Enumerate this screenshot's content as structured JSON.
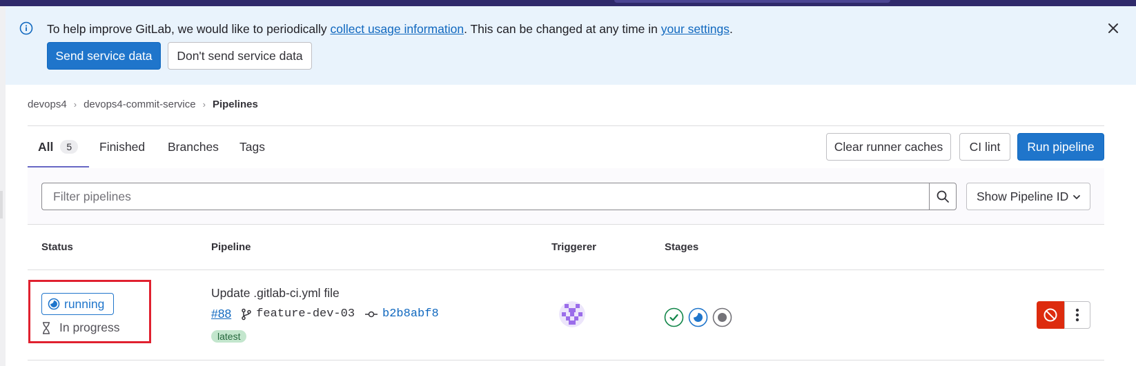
{
  "banner": {
    "text_before": "To help improve GitLab, we would like to periodically ",
    "link_usage": "collect usage information",
    "text_middle": ". This can be changed at any time in ",
    "link_settings": "your settings",
    "text_after": ".",
    "send_button": "Send service data",
    "dont_send_button": "Don't send service data"
  },
  "breadcrumb": {
    "items": [
      "devops4",
      "devops4-commit-service",
      "Pipelines"
    ]
  },
  "tabs": [
    {
      "label": "All",
      "count": "5"
    },
    {
      "label": "Finished"
    },
    {
      "label": "Branches"
    },
    {
      "label": "Tags"
    }
  ],
  "actions": {
    "clear_caches": "Clear runner caches",
    "ci_lint": "CI lint",
    "run_pipeline": "Run pipeline"
  },
  "filter": {
    "placeholder": "Filter pipelines",
    "show_id": "Show Pipeline ID"
  },
  "table": {
    "headers": [
      "Status",
      "Pipeline",
      "Triggerer",
      "Stages"
    ],
    "rows": [
      {
        "status": "running",
        "duration": "In progress",
        "title": "Update .gitlab-ci.yml file",
        "id": "#88",
        "ref": "feature-dev-03",
        "sha": "b2b8abf8",
        "badge": "latest",
        "stages": [
          "success-icon",
          "running-icon",
          "created-icon"
        ]
      }
    ]
  },
  "colors": {
    "primary": "#1f75cb",
    "danger": "#dd2b0e",
    "success": "#108548",
    "banner_bg": "#e9f3fc",
    "highlight": "#e0212f"
  }
}
